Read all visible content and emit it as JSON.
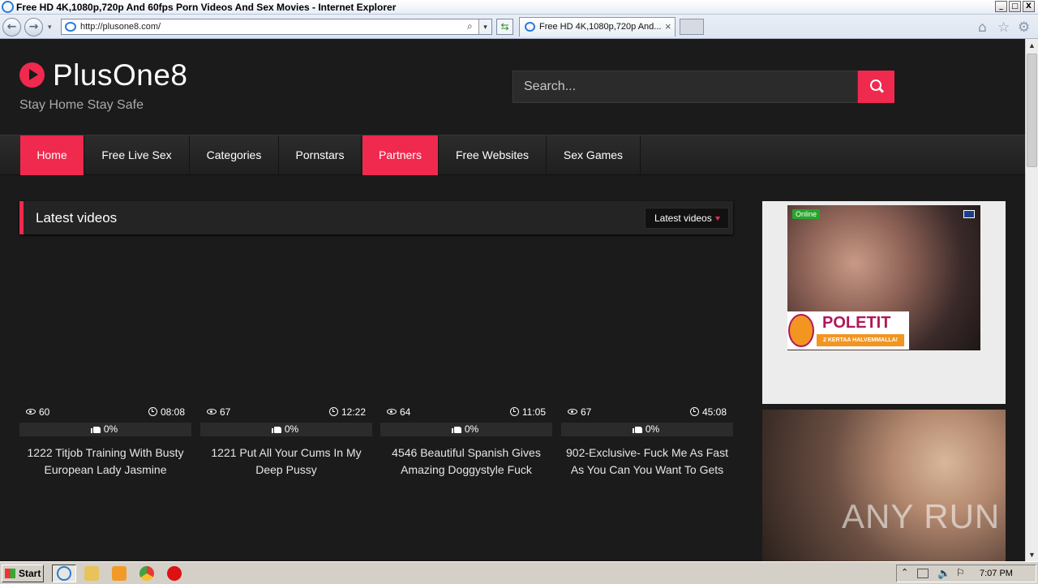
{
  "browser": {
    "window_title": "Free HD 4K,1080p,720p And 60fps Porn Videos And Sex Movies - Internet Explorer",
    "address": "http://plusone8.com/",
    "tab_label": "Free HD 4K,1080p,720p And...",
    "window_buttons": {
      "minimize": "_",
      "maximize": "□",
      "close": "X"
    },
    "nav_buttons": {
      "back": "←",
      "forward": "→",
      "dropdown": "▾",
      "refresh": "⇆",
      "tab_close": "×"
    },
    "toolbar_icons": [
      "home-icon",
      "favorites-star-icon",
      "gear-icon"
    ]
  },
  "site": {
    "logo": "PlusOne8",
    "tagline": "Stay Home Stay Safe",
    "search_placeholder": "Search...",
    "accent_color": "#f0294f"
  },
  "menu": [
    {
      "label": "Home",
      "active": true
    },
    {
      "label": "Free Live Sex",
      "active": false
    },
    {
      "label": "Categories",
      "active": false
    },
    {
      "label": "Pornstars",
      "active": false
    },
    {
      "label": "Partners",
      "active": true
    },
    {
      "label": "Free Websites",
      "active": false
    },
    {
      "label": "Sex Games",
      "active": false
    }
  ],
  "latest": {
    "heading": "Latest videos",
    "filter_label": "Latest videos"
  },
  "videos": [
    {
      "views": "60",
      "duration": "08:08",
      "rating": "0%",
      "title": "1222 Titjob Training With Busty European Lady Jasmine"
    },
    {
      "views": "67",
      "duration": "12:22",
      "rating": "0%",
      "title": "1221 Put All Your Cums In My Deep Pussy"
    },
    {
      "views": "64",
      "duration": "11:05",
      "rating": "0%",
      "title": "4546 Beautiful Spanish Gives Amazing Doggystyle Fuck"
    },
    {
      "views": "67",
      "duration": "45:08",
      "rating": "0%",
      "title": "902-Exclusive- Fuck Me As Fast As You Can You Want To Gets"
    }
  ],
  "ads": {
    "ad1_status": "Online",
    "ad1_brand": "POLETIT",
    "ad1_sub": "2 KERTAA HALVEMMALLA!",
    "ad2_watermark": "ANY RUN"
  },
  "taskbar": {
    "start_label": "Start",
    "clock": "7:07 PM"
  }
}
